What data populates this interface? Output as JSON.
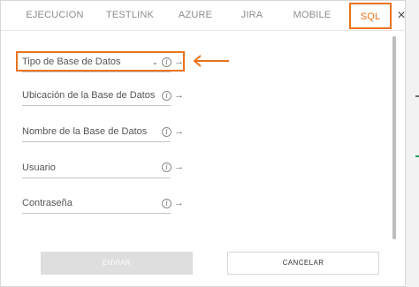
{
  "tabs": [
    {
      "label": "EJECUCION"
    },
    {
      "label": "TESTLINK"
    },
    {
      "label": "AZURE"
    },
    {
      "label": "JIRA"
    },
    {
      "label": "MOBILE"
    },
    {
      "label": "SQL",
      "active": true
    }
  ],
  "close_icon": "×",
  "fields": [
    {
      "label": "Tipo de Base de Datos",
      "type": "select"
    },
    {
      "label": "Ubicación de la Base de Datos"
    },
    {
      "label": "Nombre de la Base de Datos"
    },
    {
      "label": "Usuario"
    },
    {
      "label": "Contraseña"
    }
  ],
  "icons": {
    "info": "i",
    "arrow": "→",
    "chevron": "⌄"
  },
  "buttons": {
    "send": "ENVIAR",
    "cancel": "CANCELAR"
  },
  "colors": {
    "accent": "#e9731d",
    "disabled_button": "#dedede"
  }
}
